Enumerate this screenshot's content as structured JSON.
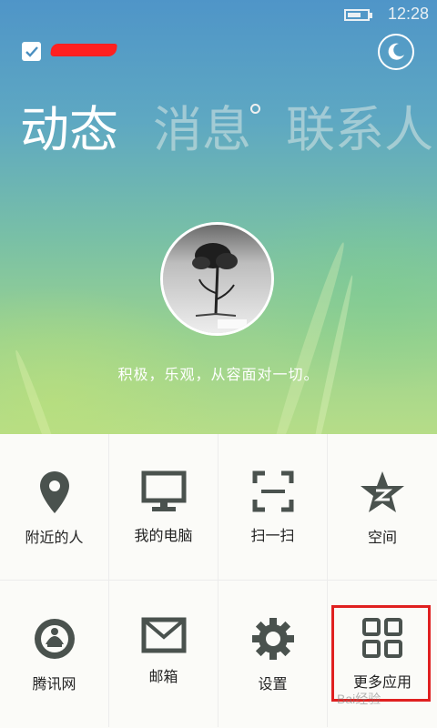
{
  "status_bar": {
    "time": "12:28",
    "battery_level": 0.7
  },
  "header": {
    "icons": [
      "checkbox-icon",
      "moon-icon"
    ]
  },
  "tabs": [
    {
      "label": "动态",
      "active": true
    },
    {
      "label": "消息",
      "active": false,
      "has_dot": true
    },
    {
      "label": "联系人",
      "active": false
    }
  ],
  "profile": {
    "signature": "积极，乐观，从容面对一切。"
  },
  "grid": {
    "items": [
      {
        "label": "附近的人",
        "icon": "location-pin-icon"
      },
      {
        "label": "我的电脑",
        "icon": "monitor-icon"
      },
      {
        "label": "扫一扫",
        "icon": "scan-icon"
      },
      {
        "label": "空间",
        "icon": "qzone-star-icon"
      },
      {
        "label": "腾讯网",
        "icon": "tencent-news-icon"
      },
      {
        "label": "邮箱",
        "icon": "mail-icon"
      },
      {
        "label": "设置",
        "icon": "gear-icon"
      },
      {
        "label": "更多应用",
        "icon": "apps-grid-icon"
      }
    ]
  },
  "colors": {
    "icon": "#4a524e",
    "highlight": "#e02020",
    "accent_text": "#ffffff"
  },
  "watermark": "Bai经验"
}
